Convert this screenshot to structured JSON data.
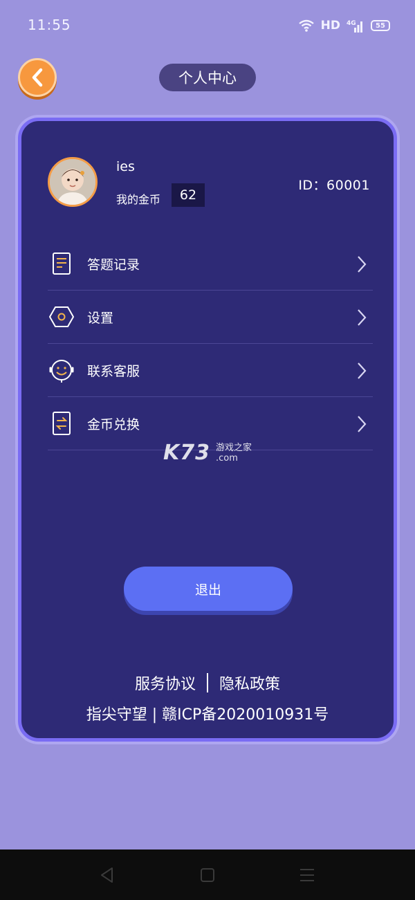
{
  "status_bar": {
    "time": "11:55",
    "network": "HD",
    "signal": "4G",
    "battery": "55",
    "icons": [
      "wifi-icon",
      "signal-icon",
      "battery-icon"
    ]
  },
  "header": {
    "title": "个人中心",
    "back_icon": "chevron-left-icon"
  },
  "profile": {
    "username": "ies",
    "coins_label": "我的金币",
    "coins_value": "62",
    "user_id": "ID：60001"
  },
  "menu": {
    "items": [
      {
        "label": "答题记录",
        "icon": "document-icon"
      },
      {
        "label": "设置",
        "icon": "settings-hexagon-icon"
      },
      {
        "label": "联系客服",
        "icon": "headset-icon"
      },
      {
        "label": "金币兑换",
        "icon": "exchange-icon"
      }
    ]
  },
  "watermark": {
    "brand": "K73",
    "line1": "游戏之家",
    "line2": ".com"
  },
  "actions": {
    "logout_label": "退出"
  },
  "footer": {
    "service_agreement": "服务协议",
    "privacy_policy": "隐私政策",
    "icp": "指尖守望 | 赣ICP备2020010931号"
  },
  "colors": {
    "background": "#9b93dd",
    "card": "#2e2a76",
    "card_border": "#7a6cf3",
    "accent_orange": "#f7983e",
    "button_blue": "#5c6ff3"
  }
}
